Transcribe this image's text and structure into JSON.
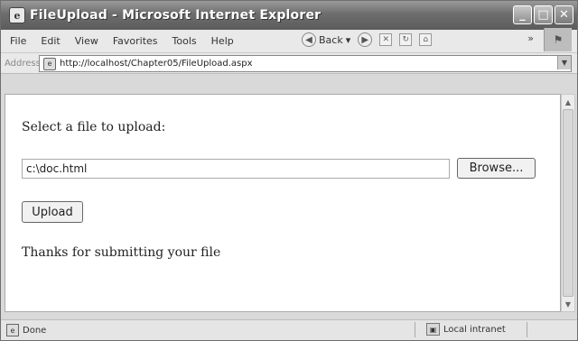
{
  "window": {
    "title": "FileUpload - Microsoft Internet Explorer",
    "icon": "ie-page-icon"
  },
  "menu": {
    "items": [
      "File",
      "Edit",
      "View",
      "Favorites",
      "Tools",
      "Help"
    ]
  },
  "toolbar": {
    "back_label": "Back",
    "chevron": "»"
  },
  "address": {
    "label": "Address",
    "url": "http://localhost/Chapter05/FileUpload.aspx"
  },
  "page": {
    "prompt": "Select a file to upload:",
    "file_value": "c:\\doc.html",
    "browse_label": "Browse...",
    "upload_label": "Upload",
    "thanks_text": "Thanks for submitting your file"
  },
  "status": {
    "text": "Done",
    "zone": "Local intranet"
  }
}
